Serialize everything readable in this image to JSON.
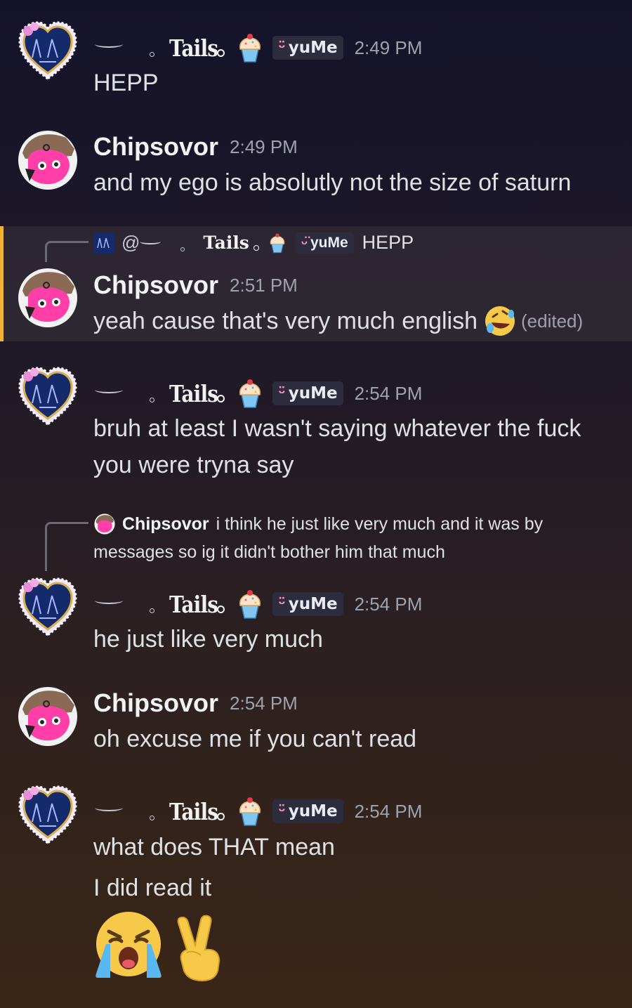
{
  "users": {
    "tails": {
      "name": "Tails",
      "tag_label": "yuMe"
    },
    "chips": {
      "name": "Chipsovor"
    }
  },
  "messages": [
    {
      "time": "2:49 PM",
      "lines": [
        "HEPP"
      ]
    },
    {
      "time": "2:49 PM",
      "lines": [
        "and my ego is absolutly not the size of saturn"
      ]
    },
    {
      "reply_preview": {
        "mention": "@",
        "text": "HEPP"
      },
      "time": "2:51 PM",
      "lines": [
        "yeah cause that's very much english"
      ],
      "edited_label": "(edited)"
    },
    {
      "time": "2:54 PM",
      "lines": [
        "bruh at least I wasn't saying whatever the fuck",
        "you were tryna say"
      ]
    },
    {
      "reply_preview": {
        "name": "Chipsovor",
        "text": "i think he just like very much and it was by",
        "text2": "messages so ig it didn't bother him that much"
      },
      "time": "2:54 PM",
      "lines": [
        "he just like very much"
      ]
    },
    {
      "time": "2:54 PM",
      "lines": [
        "oh excuse me if you can't read"
      ]
    },
    {
      "time": "2:54 PM",
      "lines": [
        "what does THAT mean",
        "I did read it"
      ],
      "emojis": [
        "loudly-crying-face",
        "victory-hand"
      ]
    }
  ],
  "colors": {
    "highlight_border": "#f0b232",
    "name_color": "#f2f3f5",
    "time_color": "#9fa2ad",
    "bunny_color": "#ff8fc4"
  }
}
